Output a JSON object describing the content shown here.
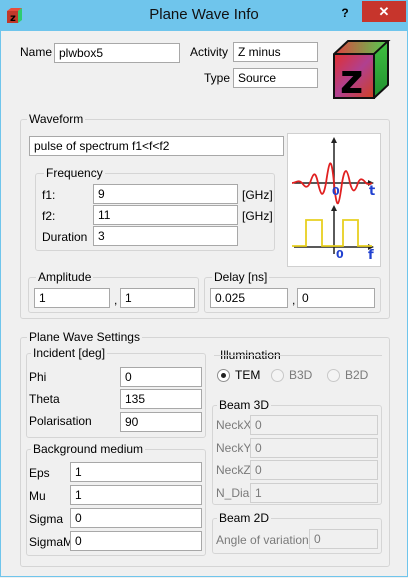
{
  "window": {
    "title": "Plane Wave Info",
    "help_label": "?",
    "close_label": "✕",
    "accent": "#6fc5ec"
  },
  "header": {
    "name_label": "Name",
    "name_value": "plwbox5",
    "activity_label": "Activity",
    "activity_value": "Z minus",
    "type_label": "Type",
    "type_value": "Source",
    "logo_letter": "z"
  },
  "waveform": {
    "title": "Waveform",
    "description": "pulse of spectrum f1<f<f2",
    "frequency": {
      "title": "Frequency",
      "f1_label": "f1:",
      "f1_value": "9",
      "f1_unit": "[GHz]",
      "f2_label": "f2:",
      "f2_value": "11",
      "f2_unit": "[GHz]",
      "duration_label": "Duration",
      "duration_value": "3"
    },
    "time_plot": {
      "origin_label": "0",
      "axis_label": "t"
    },
    "freq_plot": {
      "origin_label": "0",
      "axis_label": "f"
    },
    "amplitude": {
      "title": "Amplitude",
      "value1": "1",
      "separator": ",",
      "value2": "1"
    },
    "delay": {
      "title": "Delay [ns]",
      "value1": "0.025",
      "separator": ",",
      "value2": "0"
    }
  },
  "settings": {
    "title": "Plane Wave Settings",
    "incident": {
      "title": "Incident [deg]",
      "phi_label": "Phi",
      "phi_value": "0",
      "theta_label": "Theta",
      "theta_value": "135",
      "polarisation_label": "Polarisation",
      "polarisation_value": "90"
    },
    "background": {
      "title": "Background medium",
      "eps_label": "Eps",
      "eps_value": "1",
      "mu_label": "Mu",
      "mu_value": "1",
      "sigma_label": "Sigma",
      "sigma_value": "0",
      "sigmam_label": "SigmaM",
      "sigmam_value": "0"
    },
    "illumination": {
      "title": "Illumination",
      "options": [
        "TEM",
        "B3D",
        "B2D"
      ],
      "selected": "TEM"
    },
    "beam3d": {
      "title": "Beam 3D",
      "neckx_label": "NeckX",
      "neckx_value": "0",
      "necky_label": "NeckY",
      "necky_value": "0",
      "neckz_label": "NeckZ",
      "neckz_value": "0",
      "ndia_label": "N_Dia",
      "ndia_value": "1"
    },
    "beam2d": {
      "title": "Beam 2D",
      "angle_label": "Angle of variation",
      "angle_value": "0"
    }
  }
}
